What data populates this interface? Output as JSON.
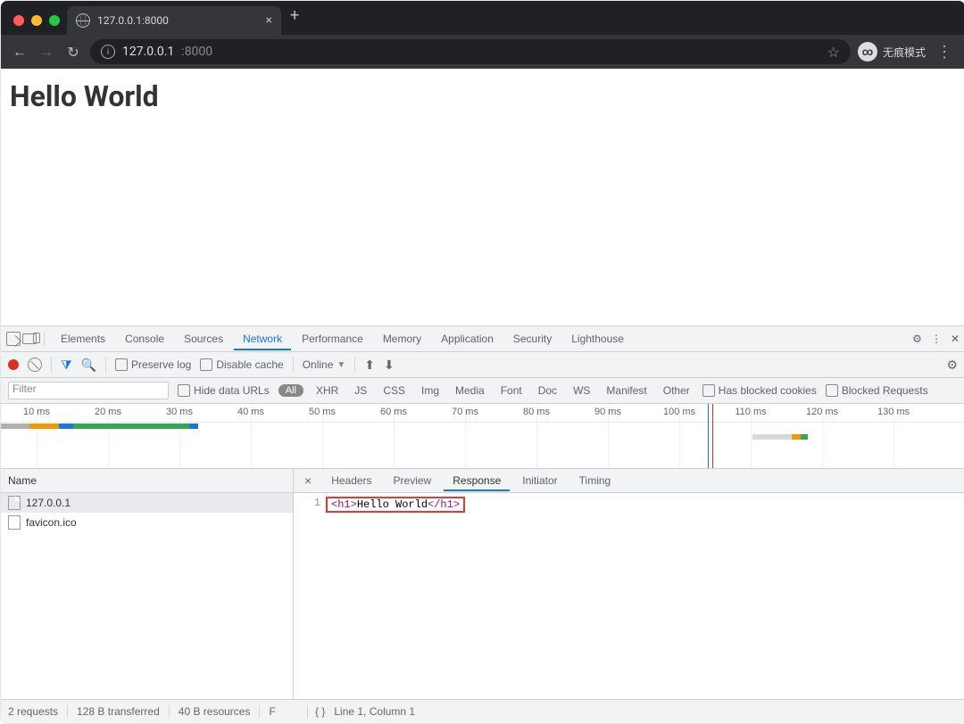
{
  "browser": {
    "tab_title": "127.0.0.1:8000",
    "new_tab_glyph": "+",
    "nav": {
      "back": "←",
      "forward": "→",
      "reload": "↻"
    },
    "address": {
      "host": "127.0.0.1",
      "port": ":8000",
      "info_glyph": "i",
      "star_glyph": "☆"
    },
    "incognito_label": "无痕模式",
    "menu_glyph": "⋮"
  },
  "page": {
    "heading": "Hello World"
  },
  "devtools": {
    "panels": [
      "Elements",
      "Console",
      "Sources",
      "Network",
      "Performance",
      "Memory",
      "Application",
      "Security",
      "Lighthouse"
    ],
    "active_panel": "Network",
    "gear_glyph": "⚙",
    "dots_glyph": "⋮",
    "close_glyph": "✕",
    "network_toolbar": {
      "preserve_log": "Preserve log",
      "disable_cache": "Disable cache",
      "throttle": "Online",
      "upload_glyph": "⬆",
      "download_glyph": "⬇",
      "funnel_glyph": "⧩",
      "search_glyph": "🔍"
    },
    "filter_bar": {
      "placeholder": "Filter",
      "hide_data_urls": "Hide data URLs",
      "all_pill": "All",
      "types": [
        "XHR",
        "JS",
        "CSS",
        "Img",
        "Media",
        "Font",
        "Doc",
        "WS",
        "Manifest",
        "Other"
      ],
      "blocked_cookies": "Has blocked cookies",
      "blocked_requests": "Blocked Requests"
    },
    "timeline_ticks": [
      "10 ms",
      "20 ms",
      "30 ms",
      "40 ms",
      "50 ms",
      "60 ms",
      "70 ms",
      "80 ms",
      "90 ms",
      "100 ms",
      "110 ms",
      "120 ms",
      "130 ms"
    ],
    "overview_segments": [
      {
        "left": "0%",
        "width": "3%",
        "color": "#b0b0b0"
      },
      {
        "left": "3%",
        "width": "3%",
        "color": "#f29900"
      },
      {
        "left": "6%",
        "width": "1.5%",
        "color": "#1a73e8"
      },
      {
        "left": "7.5%",
        "width": "12%",
        "color": "#34a853"
      },
      {
        "left": "19.5%",
        "width": "1%",
        "color": "#1a73e8"
      }
    ],
    "overview_second": [
      {
        "left": "78%",
        "width": "4%",
        "color": "#d9d9d9"
      },
      {
        "left": "82%",
        "width": "1%",
        "color": "#f29900"
      },
      {
        "left": "83%",
        "width": "0.7%",
        "color": "#34a853"
      }
    ],
    "vlines": [
      {
        "left": "73.3%",
        "color": "#1a73e8"
      },
      {
        "left": "73.8%",
        "color": "#d93025"
      }
    ],
    "requests": {
      "header": "Name",
      "items": [
        {
          "name": "127.0.0.1",
          "selected": true
        },
        {
          "name": "favicon.ico",
          "selected": false
        }
      ]
    },
    "detail_tabs": [
      "Headers",
      "Preview",
      "Response",
      "Initiator",
      "Timing"
    ],
    "active_detail_tab": "Response",
    "response_line_no": "1",
    "response_open": "<h1>",
    "response_text": "Hello World",
    "response_close": "</h1>",
    "status_bar": {
      "requests": "2 requests",
      "transferred": "128 B transferred",
      "resources": "40 B resources",
      "extra": "F",
      "braces": "{ }",
      "cursor": "Line 1, Column 1"
    }
  }
}
